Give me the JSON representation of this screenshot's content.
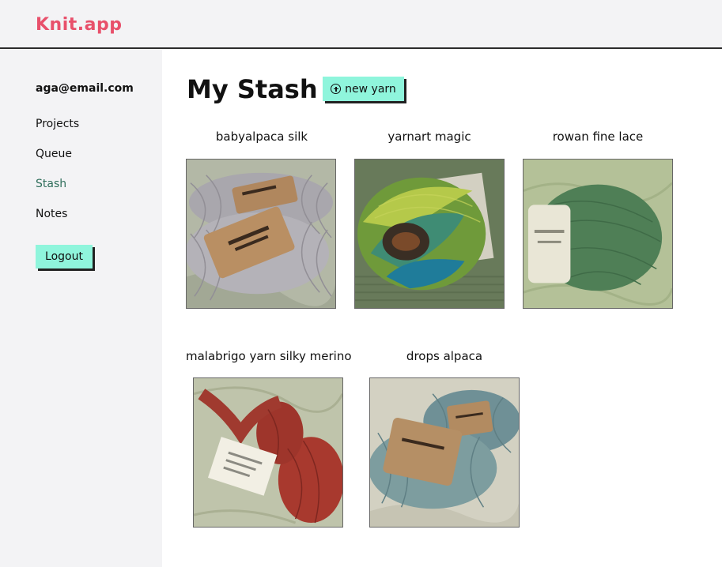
{
  "app": {
    "logo": "Knit.app"
  },
  "sidebar": {
    "user_email": "aga@email.com",
    "items": [
      {
        "label": "Projects"
      },
      {
        "label": "Queue"
      },
      {
        "label": "Stash",
        "active": true
      },
      {
        "label": "Notes"
      }
    ],
    "logout_label": "Logout"
  },
  "main": {
    "title": "My Stash",
    "new_yarn_label": "new yarn",
    "yarns": [
      {
        "name": "babyalpaca silk",
        "photo": "grey-skeins-with-kraft-labels"
      },
      {
        "name": "yarnart magic",
        "photo": "multicolor-green-blue-ball"
      },
      {
        "name": "rowan fine lace",
        "photo": "green-ball-with-white-label"
      },
      {
        "name": "malabrigo yarn silky merino",
        "photo": "red-hank-with-tag"
      },
      {
        "name": "drops alpaca",
        "photo": "sage-skeins-with-kraft-labels"
      }
    ]
  },
  "colors": {
    "accent": "#8ff5dc",
    "logo": "#e8506b",
    "active_nav": "#2f6e5b",
    "sidebar_bg": "#f3f3f5"
  }
}
